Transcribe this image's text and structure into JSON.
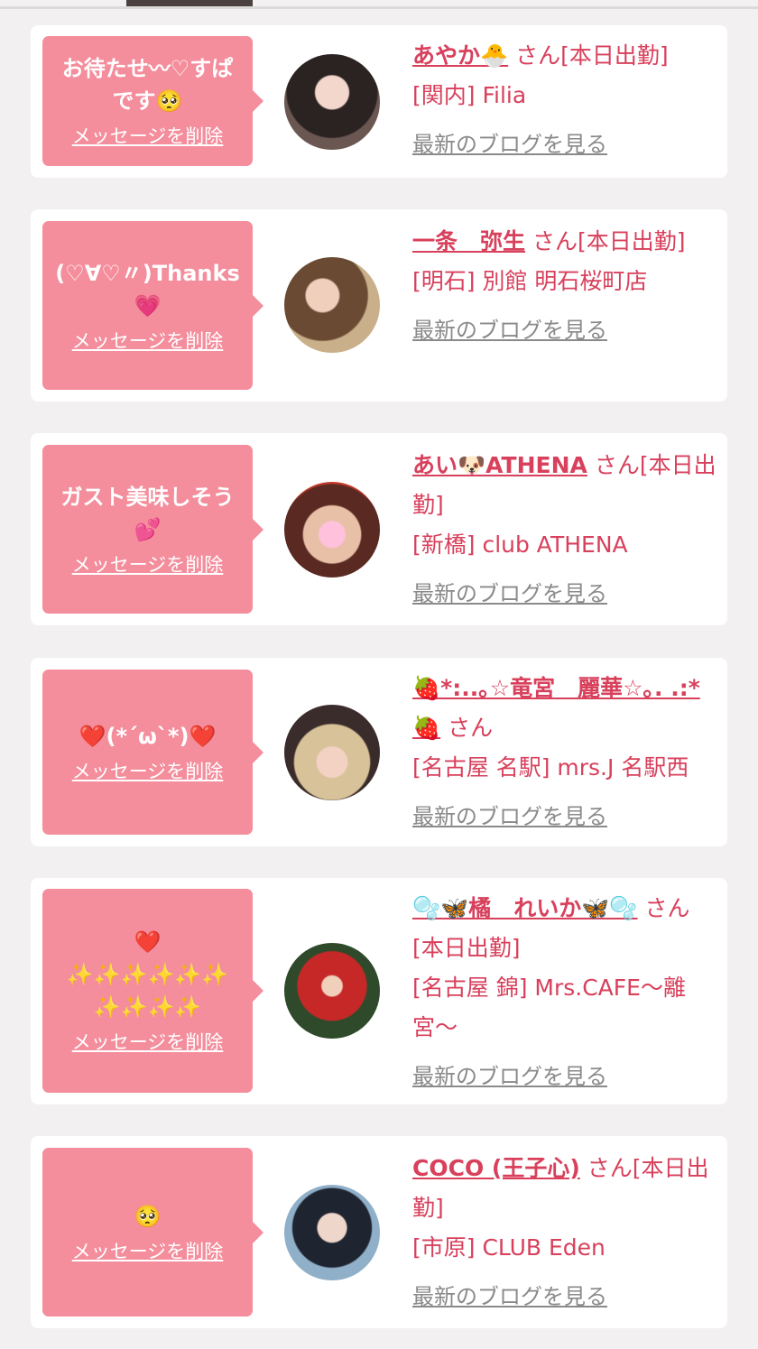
{
  "cards": [
    {
      "message": "お待たせ〰♡すぱ\nです🥺",
      "delete_label": "メッセージを削除",
      "name": "あやか🐣",
      "status": "  さん[本日出勤]",
      "shop": "[関内] Filia",
      "blog_label": "最新のブログを見る"
    },
    {
      "message": "(♡∀♡〃)Thanks💗",
      "delete_label": "メッセージを削除",
      "name": "一条　弥生",
      "status": "  さん[本日出勤]",
      "shop": "[明石] 別館 明石桜町店",
      "blog_label": "最新のブログを見る"
    },
    {
      "message": "ガスト美味しそう\n💕",
      "delete_label": "メッセージを削除",
      "name": "あい🐶ATHENA",
      "status": "  さん[本日出勤]",
      "shop": "[新橋] club ATHENA",
      "blog_label": "最新のブログを見る"
    },
    {
      "message": "❤️(*´ω`*)❤️",
      "delete_label": "メッセージを削除",
      "name": "🍓*:..｡☆竜宮　麗華☆｡. .:*🍓",
      "status": "  さん",
      "shop": "[名古屋 名駅] mrs.J 名駅西",
      "blog_label": "最新のブログを見る"
    },
    {
      "message": "❤️\n✨✨✨✨✨✨\n✨✨✨✨",
      "delete_label": "メッセージを削除",
      "name": "🫧🦋橘　れいか🦋🫧",
      "status": "  さん[本日出勤]",
      "shop": "[名古屋 錦] Mrs.CAFE〜離宮〜",
      "blog_label": "最新のブログを見る"
    },
    {
      "message": "🥺",
      "delete_label": "メッセージを削除",
      "name": "COCO (王子心)",
      "status": "  さん[本日出勤]",
      "shop": "[市原] CLUB Eden",
      "blog_label": "最新のブログを見る"
    }
  ],
  "colors": {
    "bubble": "#f48d9c",
    "accent": "#d8405c",
    "muted": "#8a8a8a",
    "background": "#f2f0f0"
  }
}
